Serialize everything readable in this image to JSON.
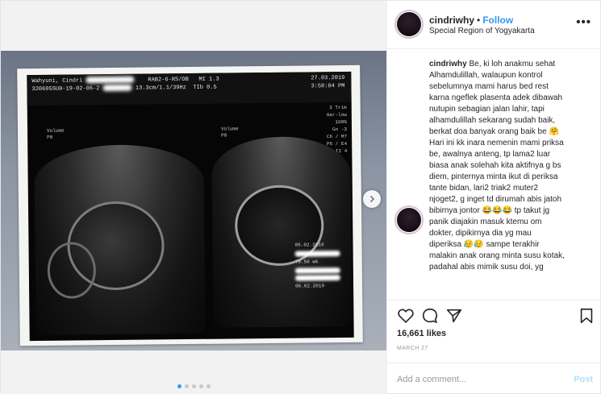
{
  "post": {
    "username": "cindriwhy",
    "follow_label": "Follow",
    "separator": "•",
    "location": "Special Region of Yogyakarta",
    "more_icon": "more-horizontal-icon",
    "caption_lines": [
      "Be, ki loh anakmu sehat",
      "Alhamdulillah, walaupun kontrol",
      "sebelumnya mami harus bed rest",
      "karna ngeflek plasenta adek dibawah",
      "nutupin sebagian jalan lahir, tapi",
      "alhamdulillah sekarang sudah baik,",
      "berkat doa banyak orang baik be 🤗",
      "Hari ini kk inara nemenin mami priksa",
      "be, awalnya anteng, tp lama2 luar",
      "biasa anak solehah kita aktifnya g bs",
      "diem, pinternya minta ikut di periksa",
      "tante bidan, lari2 triak2 muter2",
      "njoget2, g inget td dirumah abis jatoh",
      "bibirnya jontor 😂😂😂 tp takut jg",
      "panik diajakin masuk ktemu om",
      "dokter, dipikirnya dia yg mau",
      "diperiksa 😥😥 sampe terakhir",
      "malakin anak orang minta susu kotak,",
      "padahal abis mimik susu doi, yg"
    ],
    "likes": "16,661 likes",
    "date": "MARCH 27",
    "comment_placeholder": "Add a comment...",
    "post_button": "Post",
    "accent_color": "#3897f0",
    "icons": [
      "heart-icon",
      "comment-icon",
      "share-icon",
      "bookmark-icon",
      "chevron-right-icon"
    ],
    "carousel": {
      "count": 5,
      "active": 1
    }
  },
  "scan": {
    "patient": "Wahyuni, Cindri",
    "probe": "RAB2-6-RS/OB",
    "mi": "MI 1.3",
    "tib": "TIb 0.5",
    "id": "320695SU0-19-02-06-2",
    "depth": "13.3cm/1.1/39Hz",
    "date": "27.03.2019",
    "time": "3:58:04 PM",
    "trim": "3 Trim",
    "preset": "Har-low",
    "right_params": [
      "100%",
      "Gn -3",
      "C6 / M7",
      "P5 / E4",
      "SRI II 4"
    ],
    "volume_label": "Volume",
    "p_label": "P8",
    "side_dates": [
      "05.02.2019",
      "06.02.2019"
    ],
    "side_value": "79.50 wk"
  }
}
